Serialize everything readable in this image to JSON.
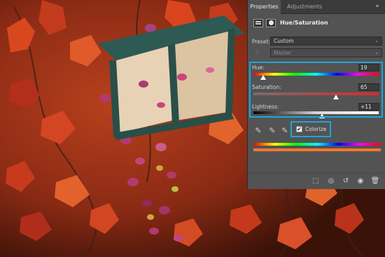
{
  "panel": {
    "tabs": [
      {
        "label": "Properties",
        "active": true
      },
      {
        "label": "Adjustments",
        "active": false
      }
    ],
    "menu_icon": "double-chevron-right",
    "title": "Hue/Saturation",
    "preset_label": "Preset:",
    "preset_value": "Custom",
    "channel_value": "Master",
    "hue": {
      "label": "Hue:",
      "value": "19",
      "position": 0.08
    },
    "saturation": {
      "label": "Saturation:",
      "value": "65",
      "position": 0.66
    },
    "lightness": {
      "label": "Lightness:",
      "value": "+11",
      "position": 0.55
    },
    "colorize": {
      "label": "Colorize",
      "checked": true
    },
    "accent_color": "#1aa6df",
    "colorized_bar_color": "#f07a2e"
  },
  "icons": {
    "adjustment_layer": "adjustment-layer-icon",
    "mask": "layer-mask-icon",
    "hand": "on-image-adjust-icon",
    "eyedroppers": [
      "eyedropper-icon",
      "eyedropper-plus-icon",
      "eyedropper-minus-icon"
    ],
    "footer": [
      "clip-to-layer-icon",
      "view-previous-icon",
      "reset-icon",
      "visibility-icon",
      "delete-icon"
    ]
  }
}
